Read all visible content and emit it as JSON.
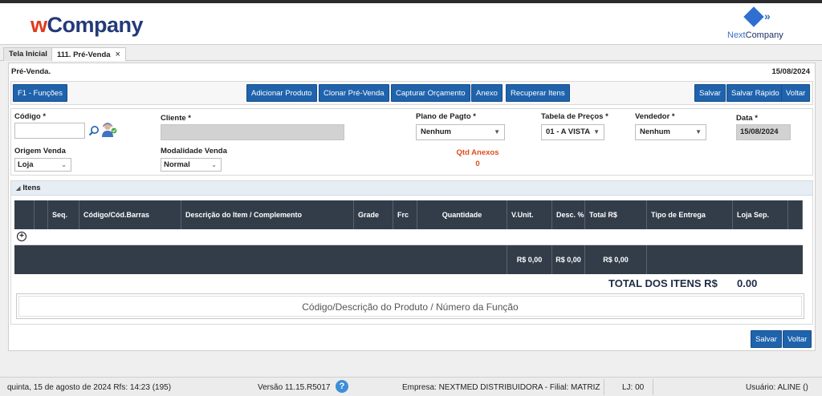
{
  "header": {
    "logo_w": "w",
    "logo_rest": "Company",
    "right_logo_next": "Next",
    "right_logo_company": "Company"
  },
  "tabs": [
    {
      "label": "Tela Inicial"
    },
    {
      "label": "111. Pré-Venda",
      "close": "×"
    }
  ],
  "page": {
    "title": "Pré-Venda.",
    "date": "15/08/2024"
  },
  "toolbar": {
    "funcoes": "F1 - Funções",
    "adicionar": "Adicionar Produto",
    "clonar": "Clonar Pré-Venda",
    "capturar": "Capturar Orçamento",
    "anexo": "Anexo",
    "recuperar": "Recuperar Itens",
    "salvar": "Salvar",
    "salvar_rapido": "Salvar Rápido",
    "voltar": "Voltar"
  },
  "form": {
    "codigo_label": "Código *",
    "codigo_value": "",
    "cliente_label": "Cliente *",
    "cliente_value": "",
    "plano_label": "Plano de Pagto *",
    "plano_value": "Nenhum",
    "tabela_label": "Tabela de Preços *",
    "tabela_value": "01 - A VISTA",
    "vendedor_label": "Vendedor *",
    "vendedor_value": "Nenhum",
    "data_label": "Data *",
    "data_value": "15/08/2024",
    "origem_label": "Origem Venda",
    "origem_value": "Loja",
    "modalidade_label": "Modalidade Venda",
    "modalidade_value": "Normal",
    "qtd_anexos_label": "Qtd Anexos",
    "qtd_anexos_value": "0"
  },
  "itens": {
    "section_title": "Itens",
    "columns": [
      "",
      "",
      "Seq.",
      "Código/Cód.Barras",
      "Descrição do Item / Complemento",
      "Grade",
      "Frc",
      "Quantidade",
      "V.Unit.",
      "Desc. %",
      "Total R$",
      "Tipo de Entrega",
      "Loja Sep.",
      ""
    ],
    "add_symbol": "+",
    "footer_vunit": "R$ 0,00",
    "footer_desc": "R$ 0,00",
    "footer_total": "R$ 0,00",
    "total_label": "TOTAL DOS ITENS R$",
    "total_value": "0.00",
    "search_placeholder": "Código/Descrição do Produto / Número da Função"
  },
  "bottom": {
    "salvar": "Salvar",
    "voltar": "Voltar"
  },
  "status": {
    "date_rfs": "quinta, 15 de agosto de 2024  Rfs: 14:23 (195)",
    "version": "Versão 11.15.R5017",
    "help": "?",
    "empresa": "Empresa: NEXTMED DISTRIBUIDORA - Filial: MATRIZ",
    "lj": "LJ: 00",
    "usuario": "Usuário: ALINE ()"
  },
  "colors": {
    "primary_button": "#1f63ad",
    "grid_header": "#333d4a",
    "logo_red": "#e03a1e",
    "logo_navy": "#233a7a",
    "qtd_anexos": "#e14b1e"
  }
}
